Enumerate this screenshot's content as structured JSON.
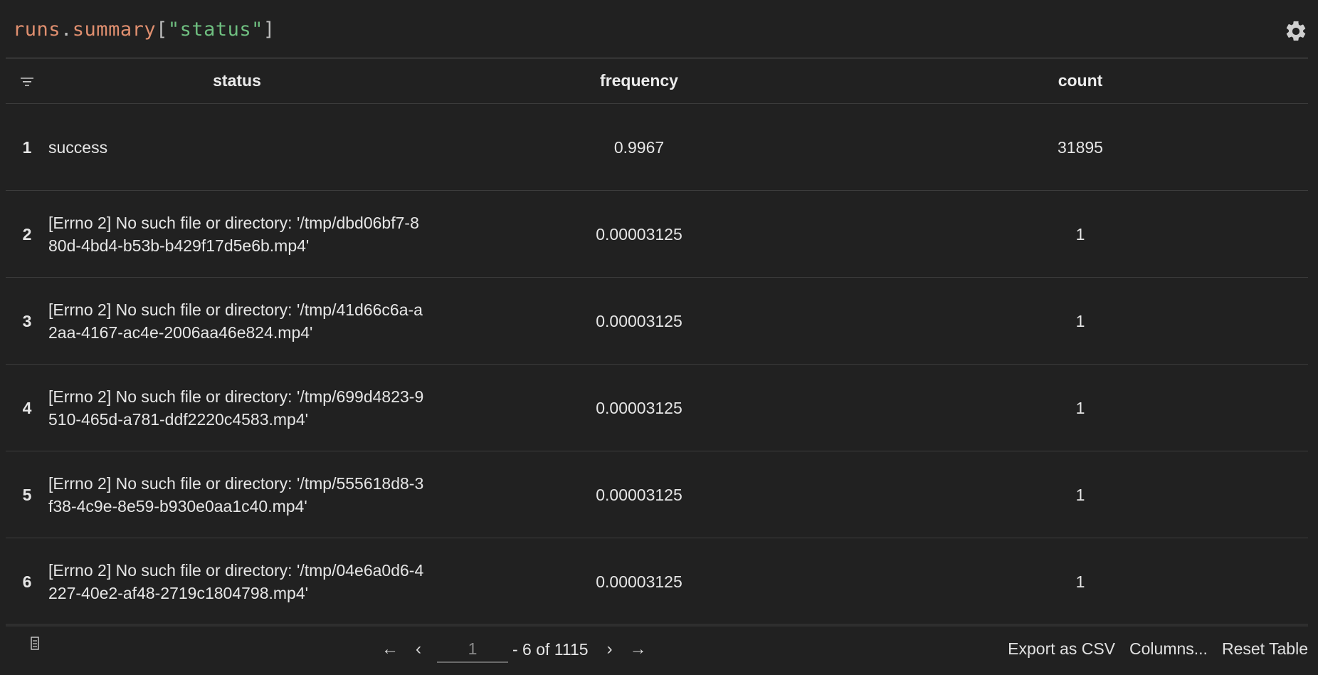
{
  "expression": {
    "object": "runs",
    "dot": ".",
    "attr": "summary",
    "open": "[",
    "key": "\"status\"",
    "close": "]"
  },
  "table": {
    "headers": {
      "status": "status",
      "frequency": "frequency",
      "count": "count"
    },
    "rows": [
      {
        "index": "1",
        "status": "success",
        "frequency": "0.9967",
        "count": "31895"
      },
      {
        "index": "2",
        "status": "[Errno 2] No such file or directory: '/tmp/dbd06bf7-880d-4bd4-b53b-b429f17d5e6b.mp4'",
        "frequency": "0.00003125",
        "count": "1"
      },
      {
        "index": "3",
        "status": "[Errno 2] No such file or directory: '/tmp/41d66c6a-a2aa-4167-ac4e-2006aa46e824.mp4'",
        "frequency": "0.00003125",
        "count": "1"
      },
      {
        "index": "4",
        "status": "[Errno 2] No such file or directory: '/tmp/699d4823-9510-465d-a781-ddf2220c4583.mp4'",
        "frequency": "0.00003125",
        "count": "1"
      },
      {
        "index": "5",
        "status": "[Errno 2] No such file or directory: '/tmp/555618d8-3f38-4c9e-8e59-b930e0aa1c40.mp4'",
        "frequency": "0.00003125",
        "count": "1"
      },
      {
        "index": "6",
        "status": "[Errno 2] No such file or directory: '/tmp/04e6a0d6-4227-40e2-af48-2719c1804798.mp4'",
        "frequency": "0.00003125",
        "count": "1"
      }
    ]
  },
  "pager": {
    "first": "←",
    "prev": "‹",
    "page_value": "1",
    "range_text": "- 6 of 1115",
    "next": "›",
    "last": "→"
  },
  "actions": {
    "export": "Export as CSV",
    "columns": "Columns...",
    "reset": "Reset Table"
  },
  "icons": {
    "settings": "gear-icon",
    "filter": "filter-icon",
    "rows": "rows-icon"
  },
  "colors": {
    "background": "#212121",
    "index": "#7ea7e8",
    "expr_object": "#e08f6f",
    "expr_string": "#6fbf80"
  }
}
